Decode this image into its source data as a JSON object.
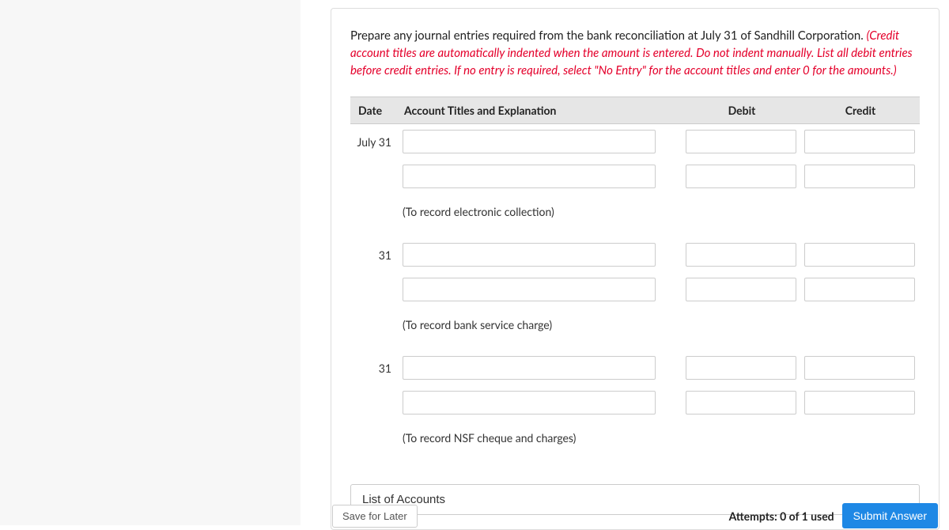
{
  "instructions": {
    "text_black": "Prepare any journal entries required from the bank reconciliation at July 31 of Sandhill Corporation. ",
    "text_red": "(Credit account titles are automatically indented when the amount is entered. Do not indent manually. List all debit entries before credit entries. If no entry is required, select \"No Entry\" for the account titles and enter 0 for the amounts.)"
  },
  "table": {
    "headers": {
      "date": "Date",
      "account": "Account Titles and Explanation",
      "debit": "Debit",
      "credit": "Credit"
    },
    "entries": [
      {
        "date": "July 31",
        "account": "",
        "debit": "",
        "credit": ""
      },
      {
        "date": "",
        "account": "",
        "debit": "",
        "credit": ""
      },
      {
        "description": "(To record electronic collection)"
      },
      {
        "date": "31",
        "account": "",
        "debit": "",
        "credit": ""
      },
      {
        "date": "",
        "account": "",
        "debit": "",
        "credit": ""
      },
      {
        "description": "(To record bank service charge)"
      },
      {
        "date": "31",
        "account": "",
        "debit": "",
        "credit": ""
      },
      {
        "date": "",
        "account": "",
        "debit": "",
        "credit": ""
      },
      {
        "description": "(To record NSF cheque and charges)"
      }
    ]
  },
  "buttons": {
    "list_of_accounts": "List of Accounts",
    "save_for_later": "Save for Later",
    "submit": "Submit Answer"
  },
  "footer": {
    "attempts": "Attempts: 0 of 1 used"
  }
}
